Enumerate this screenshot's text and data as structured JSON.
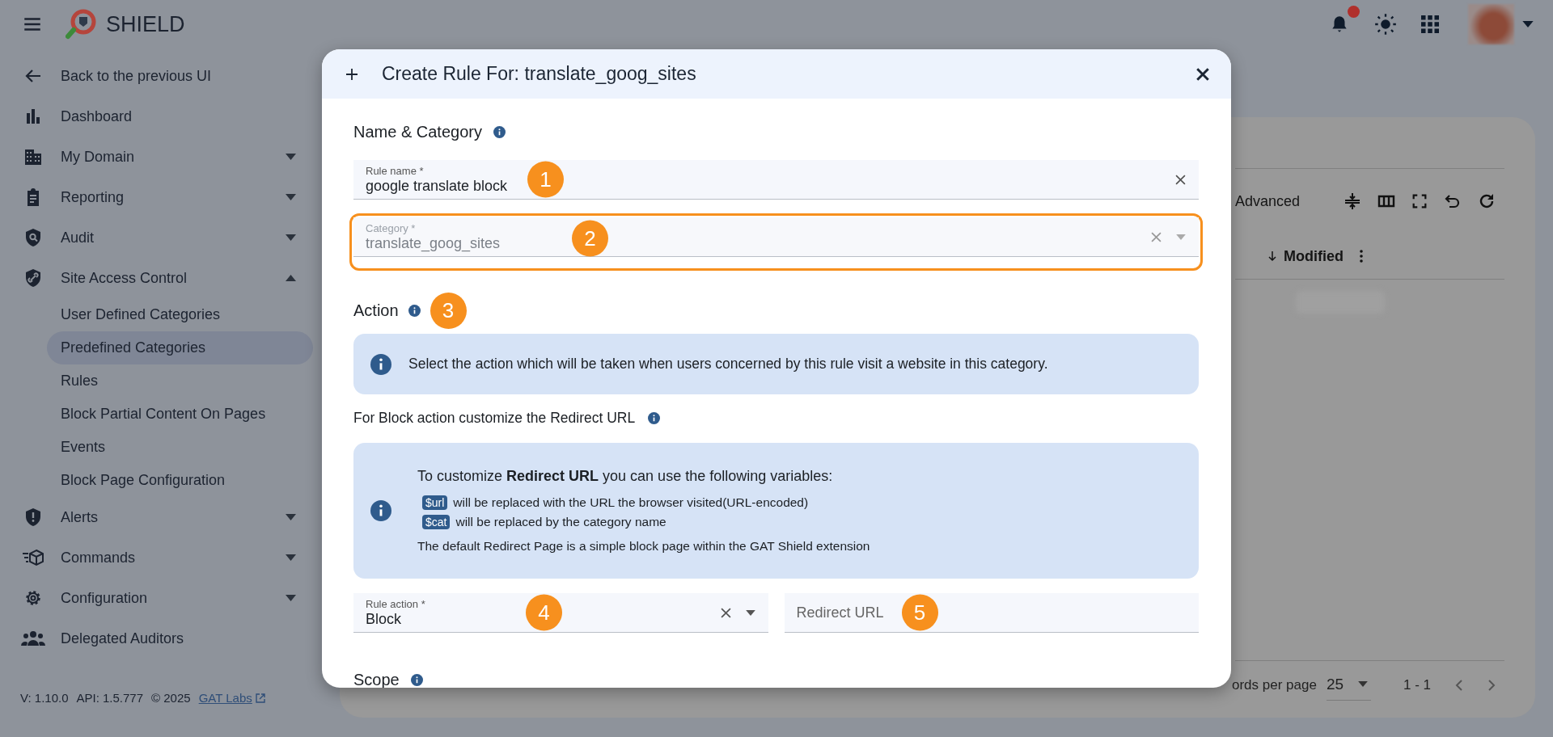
{
  "topbar": {
    "app_name": "SHIELD",
    "notification_dot": true
  },
  "sidebar": {
    "items": [
      {
        "label": "Back to the previous UI",
        "kind": "link"
      },
      {
        "label": "Dashboard",
        "kind": "link"
      },
      {
        "label": "My Domain",
        "kind": "group",
        "expanded": false
      },
      {
        "label": "Reporting",
        "kind": "group",
        "expanded": false
      },
      {
        "label": "Audit",
        "kind": "group",
        "expanded": false
      },
      {
        "label": "Site Access Control",
        "kind": "group",
        "expanded": true,
        "children": [
          {
            "label": "User Defined Categories",
            "selected": false
          },
          {
            "label": "Predefined Categories",
            "selected": true
          },
          {
            "label": "Rules",
            "selected": false
          },
          {
            "label": "Block Partial Content On Pages",
            "selected": false
          },
          {
            "label": "Events",
            "selected": false
          },
          {
            "label": "Block Page Configuration",
            "selected": false
          }
        ]
      },
      {
        "label": "Alerts",
        "kind": "group",
        "expanded": false
      },
      {
        "label": "Commands",
        "kind": "group",
        "expanded": false
      },
      {
        "label": "Configuration",
        "kind": "group",
        "expanded": false
      },
      {
        "label": "Delegated Auditors",
        "kind": "link"
      }
    ],
    "footer": {
      "version": "V: 1.10.0",
      "api": "API: 1.5.777",
      "copyright": "© 2025",
      "link": "GAT Labs"
    }
  },
  "background": {
    "toolbar_label": "Advanced",
    "column_header": "Modified",
    "records_label": "ords per page",
    "page_size": "25",
    "range": "1 - 1"
  },
  "dialog": {
    "title": "Create Rule For: translate_goog_sites",
    "name_section": "Name & Category",
    "fields_top": [
      {
        "kind": "text",
        "label": "Rule name *",
        "value": "google translate block",
        "clearable": true,
        "disabled": false,
        "highlighted": false,
        "annotation": "1"
      },
      {
        "kind": "select",
        "label": "Category *",
        "value": "translate_goog_sites",
        "clearable": true,
        "disabled": true,
        "highlighted": true,
        "annotation": "2"
      }
    ],
    "action_section": "Action",
    "action_annotation": "3",
    "action_info": "Select the action which will be taken when users concerned by this rule visit a website in this category.",
    "redirect_heading": "For Block action customize the Redirect URL",
    "redirect_info": {
      "intro": "To customize **Redirect URL** you can use the following variables:",
      "variables": [
        {
          "tag": "$url",
          "text": "will be replaced with the URL the browser visited(URL-encoded)"
        },
        {
          "tag": "$cat",
          "text": "will be replaced by the category name"
        }
      ],
      "note": "The default Redirect Page is a simple block page within the GAT Shield extension"
    },
    "fields_bottom": [
      {
        "kind": "select",
        "label": "Rule action *",
        "value": "Block",
        "clearable": true,
        "disabled": false,
        "highlighted": false,
        "annotation": "4"
      },
      {
        "kind": "text",
        "placeholder": "Redirect URL",
        "clearable": false,
        "disabled": false,
        "highlighted": false,
        "annotation": "5"
      }
    ],
    "scope_section": "Scope"
  }
}
